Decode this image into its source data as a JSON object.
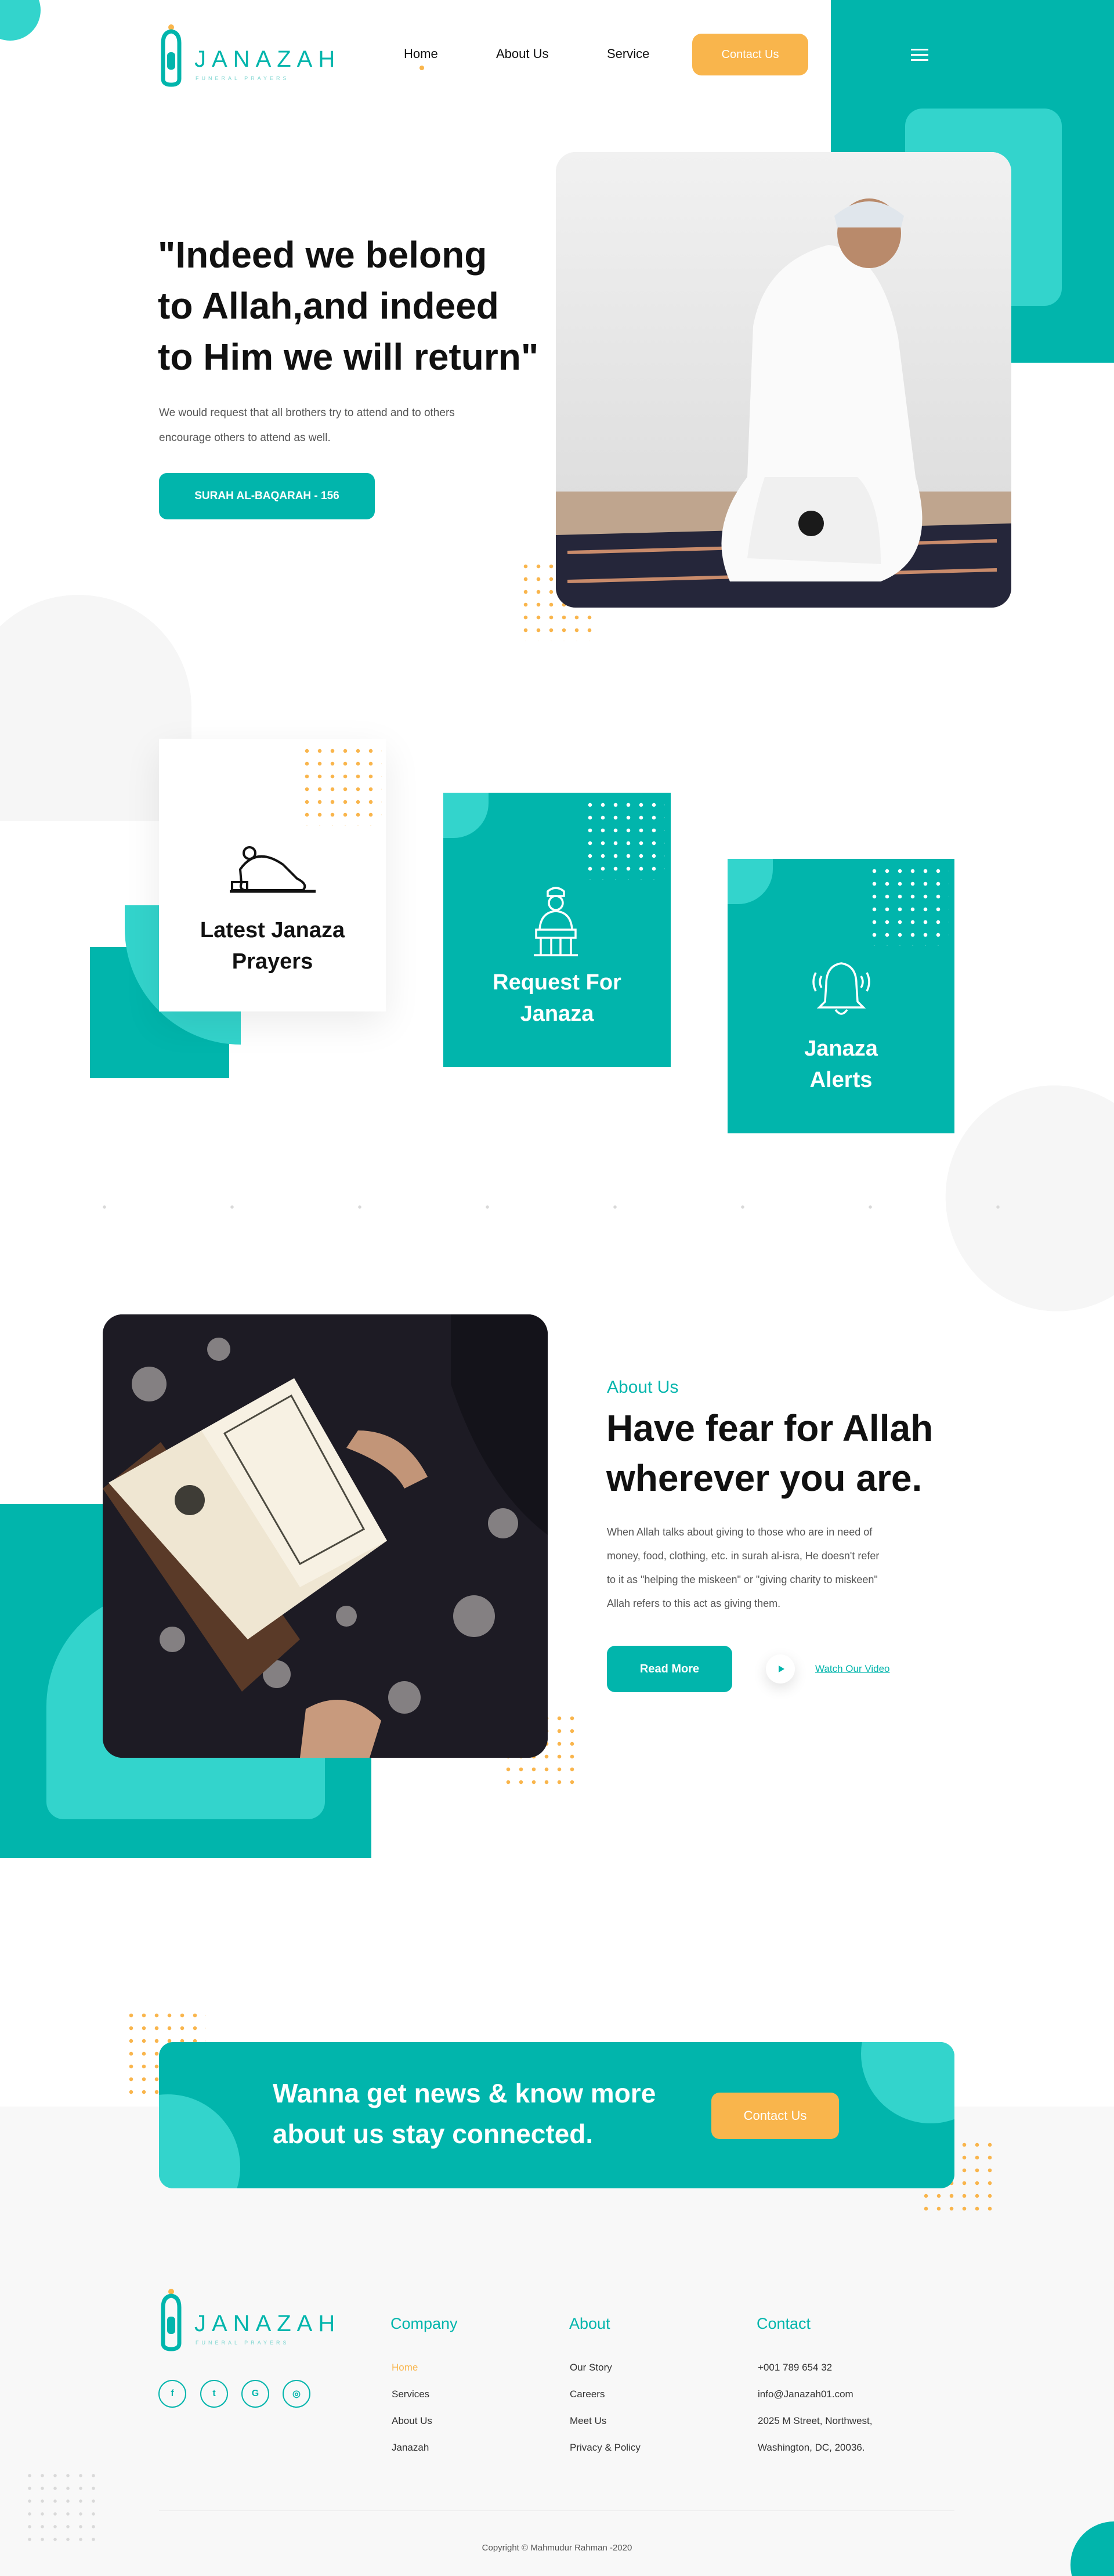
{
  "header": {
    "logo_text": "JANAZAH",
    "logo_sub": "FUNERAL PRAYERS",
    "nav": [
      "Home",
      "About Us",
      "Service"
    ],
    "contact_label": "Contact Us"
  },
  "hero": {
    "title_lines": [
      "\"Indeed we belong",
      "to Allah,and indeed",
      "to Him we will return\""
    ],
    "description_lines": [
      "We would request that all brothers try to attend and to others",
      "encourage others to attend as well."
    ],
    "button_label": "SURAH AL-BAQARAH - 156"
  },
  "services": [
    {
      "title_lines": [
        "Latest Janaza",
        "Prayers"
      ],
      "icon": "prayer-prostration-icon"
    },
    {
      "title_lines": [
        "Request For",
        "Janaza"
      ],
      "icon": "imam-podium-icon"
    },
    {
      "title_lines": [
        "Janaza",
        "Alerts"
      ],
      "icon": "bell-alert-icon"
    }
  ],
  "about": {
    "label": "About Us",
    "title_lines": [
      "Have fear for Allah",
      "wherever you are."
    ],
    "text_lines": [
      "When Allah talks about giving to those who are in need of",
      "money, food, clothing, etc. in surah al-isra, He doesn't refer",
      "to it as \"helping the miskeen\" or \"giving charity to miskeen\"",
      "Allah refers to this act as giving them."
    ],
    "read_more": "Read More",
    "watch_video": "Watch Our Video"
  },
  "newsletter": {
    "text_lines": [
      "Wanna get news & know more",
      "about us stay connected."
    ],
    "button_label": "Contact Us"
  },
  "footer": {
    "social": [
      "facebook-icon",
      "twitter-icon",
      "google-icon",
      "instagram-icon"
    ],
    "social_glyphs": [
      "f",
      "t",
      "G",
      "◎"
    ],
    "company": {
      "title": "Company",
      "links": [
        "Home",
        "Services",
        "About Us",
        "Janazah"
      ]
    },
    "about": {
      "title": "About",
      "links": [
        "Our Story",
        "Careers",
        "Meet Us",
        "Privacy & Policy"
      ]
    },
    "contact": {
      "title": "Contact",
      "lines": [
        "+001 789 654 32",
        "info@Janazah01.com",
        "2025 M Street, Northwest,",
        "Washington, DC, 20036."
      ]
    },
    "copyright": "Copyright © Mahmudur Rahman -2020"
  },
  "colors": {
    "teal": "#01b5ac",
    "teal_light": "#33d4cc",
    "orange": "#f9b54c"
  }
}
